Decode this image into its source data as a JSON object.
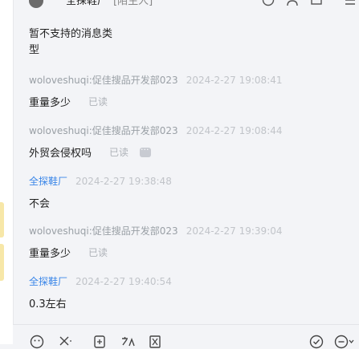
{
  "header": {
    "title": "全探鞋厂",
    "tag": "[陌生人]"
  },
  "messages": [
    {
      "sender": "",
      "time": "",
      "content_line1": "暂不支持的消息类",
      "content_line2": "型",
      "read": ""
    },
    {
      "sender": "woloveshuqi:促佳搜品开发部023",
      "time": "2024-2-27 19:08:41",
      "content": "重量多少",
      "read": "已读"
    },
    {
      "sender": "woloveshuqi:促佳搜品开发部023",
      "time": "2024-2-27 19:08:44",
      "content": "外贸会侵权吗",
      "read": "已读"
    },
    {
      "sender": "全探鞋厂",
      "time": "2024-2-27 19:38:48",
      "content": "不会",
      "read": ""
    },
    {
      "sender": "woloveshuqi:促佳搜品开发部023",
      "time": "2024-2-27 19:39:04",
      "content": "重量多少",
      "read": "已读"
    },
    {
      "sender": "全探鞋厂",
      "time": "2024-2-27 19:40:54",
      "content": "0.3左右",
      "read": ""
    }
  ],
  "colors": {
    "background": "#f3f4f7",
    "sender_self": "#9aa0a6",
    "sender_other": "#3a86e8",
    "timestamp": "#c1c4c9",
    "read_label": "#aeb2b8"
  },
  "toolbar_icons": [
    "emoji-icon",
    "scissors-icon",
    "file-icon",
    "translate-icon",
    "hourglass-icon",
    "check-circle-icon",
    "more-menu-icon"
  ]
}
